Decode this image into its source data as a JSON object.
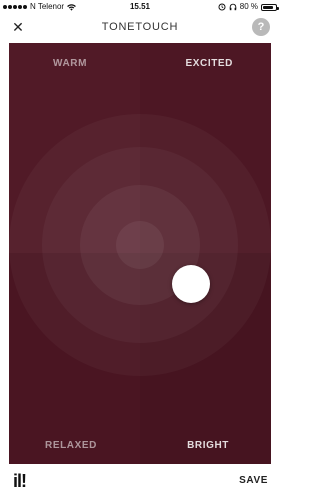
{
  "status_bar": {
    "carrier": "N Telenor",
    "time": "15.51",
    "battery": "80 %",
    "battery_level": 0.8
  },
  "nav": {
    "title": "TONETOUCH",
    "close_glyph": "✕",
    "help_glyph": "?"
  },
  "pad": {
    "labels": {
      "top_left": "WARM",
      "top_right": "EXCITED",
      "bottom_left": "RELAXED",
      "bottom_right": "BRIGHT"
    }
  },
  "bottom": {
    "logo": "il!",
    "save_label": "SAVE"
  },
  "colors": {
    "pad_background": "#4a1622",
    "knob": "#ffffff"
  },
  "icons": {
    "close": "close-icon",
    "help": "help-icon",
    "wifi": "wifi-icon",
    "alarm": "alarm-icon",
    "headphones": "headphones-icon",
    "battery": "battery-icon",
    "signal": "signal-icon",
    "logo": "logo-icon"
  }
}
